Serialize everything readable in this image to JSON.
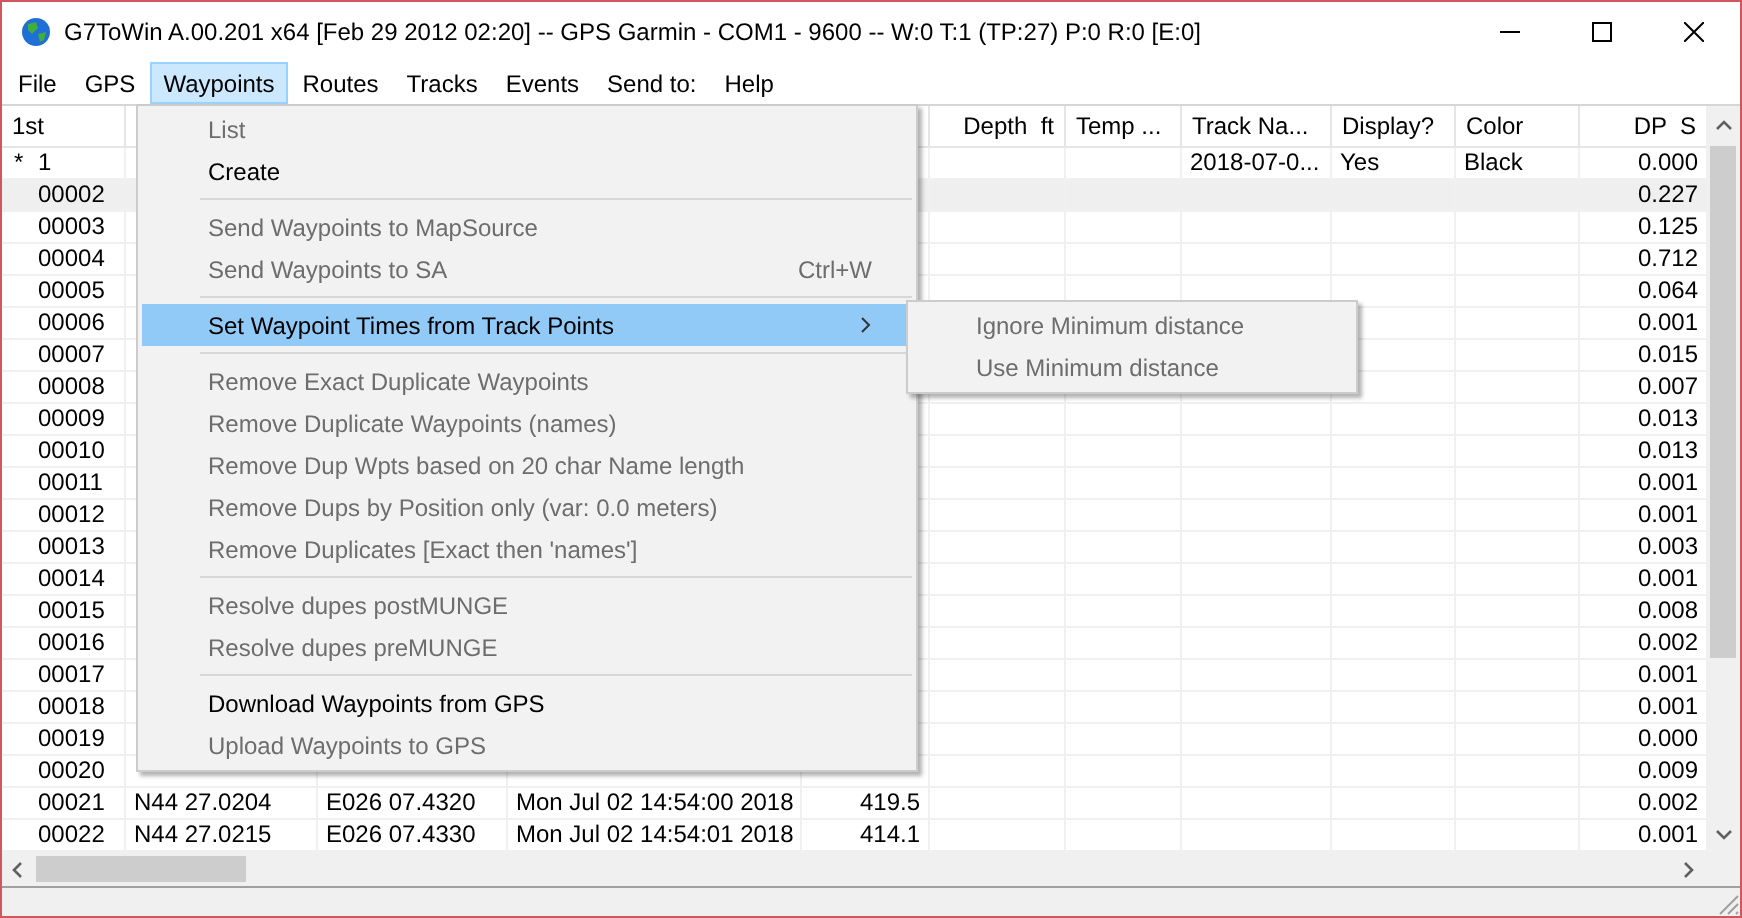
{
  "window": {
    "title": "G7ToWin A.00.201 x64 [Feb 29 2012 02:20] -- GPS Garmin - COM1 - 9600 -- W:0 T:1 (TP:27) P:0 R:0 [E:0]"
  },
  "menu_bar": [
    {
      "label": "File",
      "selected": false
    },
    {
      "label": "GPS",
      "selected": false
    },
    {
      "label": "Waypoints",
      "selected": true
    },
    {
      "label": "Routes",
      "selected": false
    },
    {
      "label": "Tracks",
      "selected": false
    },
    {
      "label": "Events",
      "selected": false
    },
    {
      "label": "Send to:",
      "selected": false
    },
    {
      "label": "Help",
      "selected": false
    }
  ],
  "menu": {
    "items": [
      {
        "kind": "item",
        "label": "List",
        "disabled": true,
        "selected": false
      },
      {
        "kind": "item",
        "label": "Create",
        "disabled": false,
        "selected": false
      },
      {
        "kind": "separator"
      },
      {
        "kind": "item",
        "label": "Send Waypoints to MapSource",
        "disabled": true,
        "selected": false
      },
      {
        "kind": "item",
        "label": "Send Waypoints to SA",
        "shortcut": "Ctrl+W",
        "disabled": true,
        "selected": false
      },
      {
        "kind": "separator"
      },
      {
        "kind": "item",
        "label": "Set Waypoint Times from Track Points",
        "disabled": false,
        "selected": true,
        "submenu": [
          {
            "label": "Ignore Minimum distance",
            "disabled": true,
            "selected": false
          },
          {
            "label": "Use Minimum distance",
            "disabled": true,
            "selected": false
          }
        ]
      },
      {
        "kind": "separator"
      },
      {
        "kind": "item",
        "label": "Remove Exact Duplicate Waypoints",
        "disabled": true,
        "selected": false
      },
      {
        "kind": "item",
        "label": "Remove Duplicate Waypoints (names)",
        "disabled": true,
        "selected": false
      },
      {
        "kind": "item",
        "label": "Remove Dup Wpts based on 20 char Name length",
        "disabled": true,
        "selected": false
      },
      {
        "kind": "item",
        "label": "Remove Dups by Position only (var: 0.0 meters)",
        "disabled": true,
        "selected": false
      },
      {
        "kind": "item",
        "label": "Remove Duplicates [Exact then 'names']",
        "disabled": true,
        "selected": false
      },
      {
        "kind": "separator"
      },
      {
        "kind": "item",
        "label": "Resolve dupes postMUNGE",
        "disabled": true,
        "selected": false
      },
      {
        "kind": "item",
        "label": "Resolve dupes preMUNGE",
        "disabled": true,
        "selected": false
      },
      {
        "kind": "separator"
      },
      {
        "kind": "item",
        "label": "Download Waypoints from GPS",
        "disabled": false,
        "selected": false
      },
      {
        "kind": "item",
        "label": "Upload Waypoints to GPS",
        "disabled": true,
        "selected": false
      }
    ]
  },
  "table": {
    "columns": [
      "1st",
      null,
      null,
      null,
      null,
      "Depth  ft",
      "Temp ...",
      "Track Na...",
      "Display?",
      "Color",
      "DP  S"
    ],
    "rows": [
      {
        "marker": "*",
        "selected": false,
        "cells": [
          "1",
          null,
          null,
          null,
          null,
          null,
          null,
          "2018-07-0...",
          "Yes",
          "Black",
          "0.000"
        ]
      },
      {
        "selected": true,
        "cells": [
          "00002",
          null,
          null,
          null,
          null,
          null,
          null,
          null,
          null,
          null,
          "0.227"
        ]
      },
      {
        "selected": false,
        "cells": [
          "00003",
          null,
          null,
          null,
          null,
          null,
          null,
          null,
          null,
          null,
          "0.125"
        ]
      },
      {
        "selected": false,
        "cells": [
          "00004",
          null,
          null,
          null,
          null,
          null,
          null,
          null,
          null,
          null,
          "0.712"
        ]
      },
      {
        "selected": false,
        "cells": [
          "00005",
          null,
          null,
          null,
          null,
          null,
          null,
          null,
          null,
          null,
          "0.064"
        ]
      },
      {
        "selected": false,
        "cells": [
          "00006",
          null,
          null,
          null,
          null,
          null,
          null,
          null,
          null,
          null,
          "0.001"
        ]
      },
      {
        "selected": false,
        "cells": [
          "00007",
          null,
          null,
          null,
          null,
          null,
          null,
          null,
          null,
          null,
          "0.015"
        ]
      },
      {
        "selected": false,
        "cells": [
          "00008",
          null,
          null,
          null,
          null,
          null,
          null,
          null,
          null,
          null,
          "0.007"
        ]
      },
      {
        "selected": false,
        "cells": [
          "00009",
          null,
          null,
          null,
          null,
          null,
          null,
          null,
          null,
          null,
          "0.013"
        ]
      },
      {
        "selected": false,
        "cells": [
          "00010",
          null,
          null,
          null,
          null,
          null,
          null,
          null,
          null,
          null,
          "0.013"
        ]
      },
      {
        "selected": false,
        "cells": [
          "00011",
          null,
          null,
          null,
          null,
          null,
          null,
          null,
          null,
          null,
          "0.001"
        ]
      },
      {
        "selected": false,
        "cells": [
          "00012",
          null,
          null,
          null,
          null,
          null,
          null,
          null,
          null,
          null,
          "0.001"
        ]
      },
      {
        "selected": false,
        "cells": [
          "00013",
          null,
          null,
          null,
          null,
          null,
          null,
          null,
          null,
          null,
          "0.003"
        ]
      },
      {
        "selected": false,
        "cells": [
          "00014",
          null,
          null,
          null,
          null,
          null,
          null,
          null,
          null,
          null,
          "0.001"
        ]
      },
      {
        "selected": false,
        "cells": [
          "00015",
          null,
          null,
          null,
          null,
          null,
          null,
          null,
          null,
          null,
          "0.008"
        ]
      },
      {
        "selected": false,
        "cells": [
          "00016",
          null,
          null,
          null,
          null,
          null,
          null,
          null,
          null,
          null,
          "0.002"
        ]
      },
      {
        "selected": false,
        "cells": [
          "00017",
          null,
          null,
          null,
          null,
          null,
          null,
          null,
          null,
          null,
          "0.001"
        ]
      },
      {
        "selected": false,
        "cells": [
          "00018",
          null,
          null,
          null,
          null,
          null,
          null,
          null,
          null,
          null,
          "0.001"
        ]
      },
      {
        "selected": false,
        "cells": [
          "00019",
          null,
          null,
          null,
          null,
          null,
          null,
          null,
          null,
          null,
          "0.000"
        ]
      },
      {
        "selected": false,
        "cells": [
          "00020",
          null,
          null,
          null,
          null,
          null,
          null,
          null,
          null,
          null,
          "0.009"
        ]
      },
      {
        "selected": false,
        "cells": [
          "00021",
          "N44 27.0204",
          "E026 07.4320",
          "Mon Jul 02 14:54:00 2018",
          "419.5",
          null,
          null,
          null,
          null,
          null,
          "0.002"
        ]
      },
      {
        "selected": false,
        "cells": [
          "00022",
          "N44 27.0215",
          "E026 07.4330",
          "Mon Jul 02 14:54:01 2018",
          "414.1",
          null,
          null,
          null,
          null,
          null,
          "0.001"
        ]
      }
    ]
  }
}
